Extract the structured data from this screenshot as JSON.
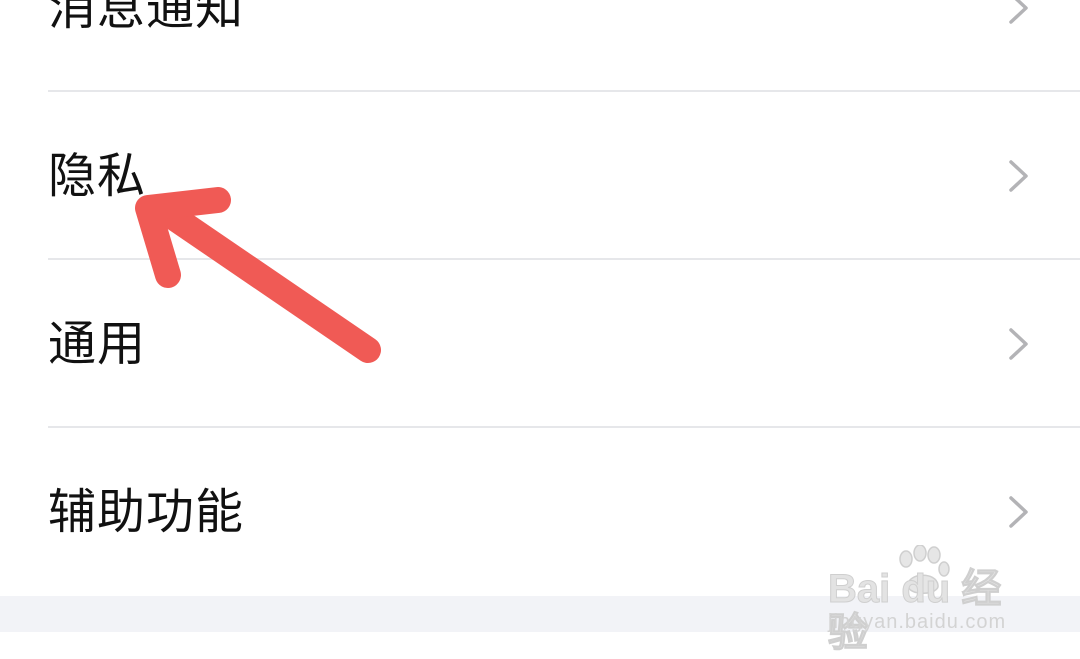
{
  "settings": {
    "items": [
      {
        "label": "消息通知"
      },
      {
        "label": "隐私"
      },
      {
        "label": "通用"
      },
      {
        "label": "辅助功能"
      }
    ]
  },
  "annotation": {
    "arrow_color": "#f05a55"
  },
  "watermark": {
    "logo_text": "Bai du 经验",
    "subtitle": "jingyan.baidu.com"
  }
}
